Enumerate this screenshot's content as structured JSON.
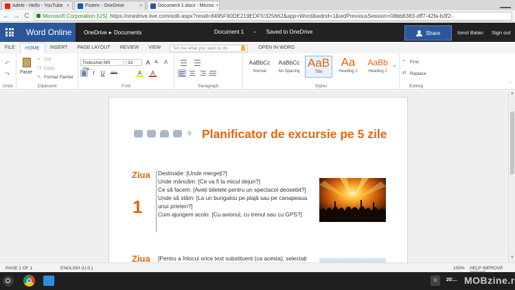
{
  "browser": {
    "tabs": [
      {
        "label": "Adele - Hello - YouTube",
        "color": "#e62117"
      },
      {
        "label": "Fisiere - OneDrive",
        "color": "#0a5cba"
      },
      {
        "label": "Document 1.docx - Micros",
        "color": "#2b579a"
      }
    ],
    "close_glyph": "×",
    "nav": {
      "back": "←",
      "forward": "→",
      "reload": "C"
    },
    "corp_label": "Microsoft Corporation [US]",
    "url": "https://onedrive.live.com/edit.aspx?resid=8495F90DE219EDF5!325662&app=Word&wdnd=1&wdPreviousSession=08bb8383-dff7-42fa-b3f2-"
  },
  "office": {
    "app_name": "Word Online",
    "breadcrumb_root": "OneDrive",
    "breadcrumb_sep": "▸",
    "breadcrumb_folder": "Documents",
    "doc_name": "Document 1",
    "dash": "–",
    "save_status": "Saved to OneDrive",
    "share_label": "Share",
    "user_name": "Ionut Balan",
    "sign_out": "Sign out",
    "brand_color": "#2b579a"
  },
  "ribbon_tabs": [
    "FILE",
    "HOME",
    "INSERT",
    "PAGE LAYOUT",
    "REVIEW",
    "VIEW"
  ],
  "tell_me_placeholder": "Tell me what you want to do",
  "open_in_word": "OPEN IN WORD",
  "ribbon": {
    "undo_label": "Undo",
    "clipboard": {
      "paste": "Paste",
      "cut": "Cut",
      "copy": "Copy",
      "format_painter": "Format Painter",
      "label": "Clipboard"
    },
    "font": {
      "name": "Trebuchet MS (He...",
      "size": "33",
      "label": "Font",
      "bold": "B",
      "italic": "I",
      "underline": "U",
      "strike": "abc",
      "highlight": "A",
      "color": "A",
      "grow": "A",
      "shrink": "A",
      "clear": "A"
    },
    "paragraph_label": "Paragraph",
    "styles": {
      "label": "Styles",
      "items": [
        {
          "sample": "AaBbCc",
          "name": "Normal"
        },
        {
          "sample": "AaBbCc",
          "name": "No Spacing"
        },
        {
          "sample": "AaB",
          "name": "Title"
        },
        {
          "sample": "Aa",
          "name": "Heading 1"
        },
        {
          "sample": "AaBb",
          "name": "Heading 2"
        }
      ]
    },
    "editing": {
      "find": "Find",
      "replace": "Replace",
      "label": "Editing"
    }
  },
  "document": {
    "title": "Planificator de excursie pe 5 zile",
    "accent_color": "#e2660f",
    "day_label": "Ziua",
    "day_number": "1",
    "itinerary": [
      "Destinație: [Unde mergeți?]",
      "Unde mâncăm: [Ce va fi la micul dejun?]",
      "Ce să facem: [Aveți biletele pentru un spectacol deosebit?]",
      "Unde să stăm: [La un bungalou pe plajă sau pe canapeaua unui prieten?]",
      "Cum ajungem acolo: [Cu avionul, cu trenul sau cu GPS?]"
    ],
    "day2_label": "Ziua",
    "day2_text": "[Pentru a înlocui orice text substituent (ca acesta), selectați pur și simplu o linie sau un paragraf de text și începeți să"
  },
  "status": {
    "page": "PAGE 1 OF 1",
    "language": "ENGLISH (U.S.)",
    "zoom": "100%",
    "help": "HELP IMPROVE OFFICE"
  },
  "taskbar": {
    "badge": "0",
    "time": "20:..."
  },
  "watermark": "MOBzine.ro"
}
